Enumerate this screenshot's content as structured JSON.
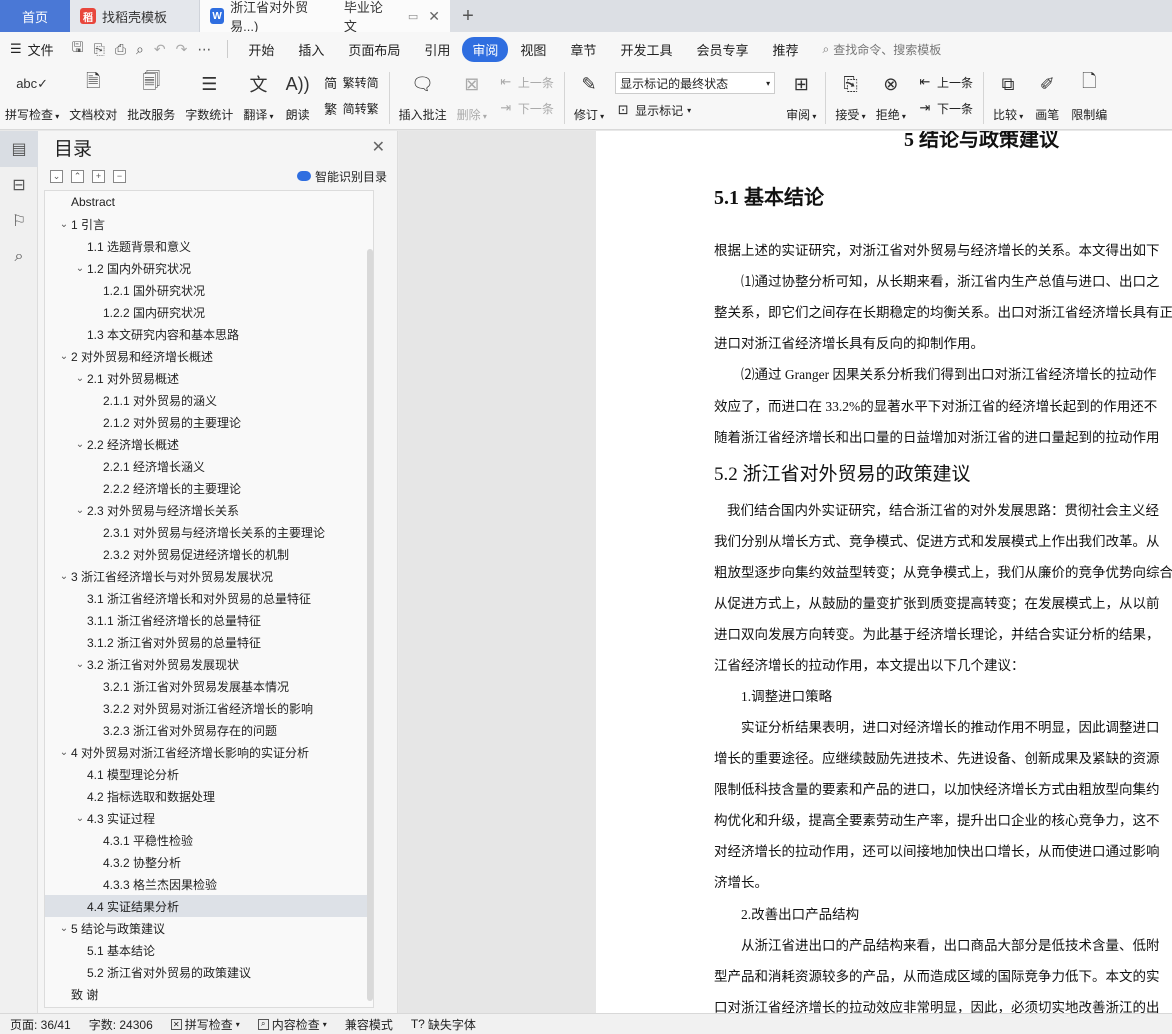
{
  "tabs": {
    "home": "首页",
    "t1": "找稻壳模板",
    "t2": "浙江省对外贸易...)",
    "t2_extra": "毕业论文",
    "add": "+"
  },
  "menu": {
    "file": "文件",
    "items": [
      "开始",
      "插入",
      "页面布局",
      "引用",
      "审阅",
      "视图",
      "章节",
      "开发工具",
      "会员专享",
      "推荐"
    ],
    "search": "查找命令、搜索模板"
  },
  "ribbon": {
    "spell": "拼写检查",
    "proof": "文档校对",
    "batch": "批改服务",
    "count": "字数统计",
    "translate": "翻译",
    "read": "朗读",
    "trad": "繁转简",
    "simp": "简转繁",
    "insert_comment": "插入批注",
    "delete": "删除",
    "prev": "上一条",
    "next": "下一条",
    "revise": "修订",
    "display_mode": "显示标记的最终状态",
    "show_marks": "显示标记",
    "review": "审阅",
    "accept": "接受",
    "reject": "拒绝",
    "prev2": "上一条",
    "next2": "下一条",
    "compare": "比较",
    "pen": "画笔",
    "restrict": "限制编"
  },
  "toc": {
    "title": "目录",
    "smart": "智能识别目录",
    "items": [
      {
        "text": "Abstract",
        "level": "lv1n",
        "arrow": ""
      },
      {
        "text": "1  引言",
        "level": "lv1",
        "arrow": "v"
      },
      {
        "text": "1.1  选题背景和意义",
        "level": "lv2n",
        "arrow": ""
      },
      {
        "text": "1.2  国内外研究状况",
        "level": "lv2",
        "arrow": "v"
      },
      {
        "text": "1.2.1    国外研究状况",
        "level": "lv3n",
        "arrow": ""
      },
      {
        "text": "1.2.2    国内研究状况",
        "level": "lv3n",
        "arrow": ""
      },
      {
        "text": "1.3  本文研究内容和基本思路",
        "level": "lv2n",
        "arrow": ""
      },
      {
        "text": "2  对外贸易和经济增长概述",
        "level": "lv1",
        "arrow": "v"
      },
      {
        "text": "2.1  对外贸易概述",
        "level": "lv2",
        "arrow": "v"
      },
      {
        "text": "2.1.1    对外贸易的涵义",
        "level": "lv3n",
        "arrow": ""
      },
      {
        "text": "2.1.2 对外贸易的主要理论",
        "level": "lv3n",
        "arrow": ""
      },
      {
        "text": "2.2 经济增长概述",
        "level": "lv2",
        "arrow": "v"
      },
      {
        "text": "2.2.1 经济增长涵义",
        "level": "lv3n",
        "arrow": ""
      },
      {
        "text": "2.2.2 经济增长的主要理论",
        "level": "lv3n",
        "arrow": ""
      },
      {
        "text": "2.3 对外贸易与经济增长关系",
        "level": "lv2",
        "arrow": "v"
      },
      {
        "text": "2.3.1 对外贸易与经济增长关系的主要理论",
        "level": "lv3n",
        "arrow": ""
      },
      {
        "text": "2.3.2 对外贸易促进经济增长的机制",
        "level": "lv3n",
        "arrow": ""
      },
      {
        "text": "3  浙江省经济增长与对外贸易发展状况",
        "level": "lv1",
        "arrow": "v"
      },
      {
        "text": "3.1  浙江省经济增长和对外贸易的总量特征",
        "level": "lv2n",
        "arrow": ""
      },
      {
        "text": "3.1.1 浙江省经济增长的总量特征",
        "level": "lv2n",
        "arrow": ""
      },
      {
        "text": "3.1.2 浙江省对外贸易的总量特征",
        "level": "lv2n",
        "arrow": ""
      },
      {
        "text": "3.2  浙江省对外贸易发展现状",
        "level": "lv2",
        "arrow": "v"
      },
      {
        "text": "3.2.1 浙江省对外贸易发展基本情况",
        "level": "lv3n",
        "arrow": ""
      },
      {
        "text": "3.2.2 对外贸易对浙江省经济增长的影响",
        "level": "lv3n",
        "arrow": ""
      },
      {
        "text": "3.2.3 浙江省对外贸易存在的问题",
        "level": "lv3n",
        "arrow": ""
      },
      {
        "text": "4  对外贸易对浙江省经济增长影响的实证分析",
        "level": "lv1",
        "arrow": "v"
      },
      {
        "text": "4.1  模型理论分析",
        "level": "lv2n",
        "arrow": ""
      },
      {
        "text": "4.2 指标选取和数据处理",
        "level": "lv2n",
        "arrow": ""
      },
      {
        "text": "4.3 实证过程",
        "level": "lv2",
        "arrow": "v"
      },
      {
        "text": "4.3.1 平稳性检验",
        "level": "lv3n",
        "arrow": ""
      },
      {
        "text": "4.3.2 协整分析",
        "level": "lv3n",
        "arrow": ""
      },
      {
        "text": "4.3.3 格兰杰因果检验",
        "level": "lv3n",
        "arrow": ""
      },
      {
        "text": "4.4 实证结果分析",
        "level": "lv2n",
        "arrow": "",
        "selected": true
      },
      {
        "text": "5  结论与政策建议",
        "level": "lv1",
        "arrow": "v"
      },
      {
        "text": "5.1 基本结论",
        "level": "lv2n",
        "arrow": ""
      },
      {
        "text": "5.2 浙江省对外贸易的政策建议",
        "level": "lv2n",
        "arrow": ""
      },
      {
        "text": "致  谢",
        "level": "lv1n",
        "arrow": ""
      }
    ]
  },
  "doc": {
    "chapter": "5  结论与政策建议",
    "h51": "5.1 基本结论",
    "p1": "根据上述的实证研究，对浙江省对外贸易与经济增长的关系。本文得出如下",
    "p2": "⑴通过协整分析可知，从长期来看，浙江省内生产总值与进口、出口之",
    "p3": "整关系，即它们之间存在长期稳定的均衡关系。出口对浙江省经济增长具有正",
    "p4": "进口对浙江省经济增长具有反向的抑制作用。",
    "p5": "⑵通过 Granger 因果关系分析我们得到出口对浙江省经济增长的拉动作",
    "p6": "效应了，而进口在 33.2%的显著水平下对浙江省的经济增长起到的作用还不",
    "p7": "随着浙江省经济增长和出口量的日益增加对浙江省的进口量起到的拉动作用",
    "h52": "5.2 浙江省对外贸易的政策建议",
    "p8": "我们结合国内外实证研究，结合浙江省的对外发展思路：贯彻社会主义经",
    "p9": "我们分别从增长方式、竞争模式、促进方式和发展模式上作出我们改革。从",
    "p10": "粗放型逐步向集约效益型转变；从竞争模式上，我们从廉价的竞争优势向综合",
    "p11": "从促进方式上，从鼓励的量变扩张到质变提高转变；在发展模式上，从以前",
    "p12": "进口双向发展方向转变。为此基于经济增长理论，并结合实证分析的结果，",
    "p13": "江省经济增长的拉动作用，本文提出以下几个建议：",
    "p14": "1.调整进口策略",
    "p15": "实证分析结果表明，进口对经济增长的推动作用不明显，因此调整进口",
    "p16": "增长的重要途径。应继续鼓励先进技术、先进设备、创新成果及紧缺的资源",
    "p17": "限制低科技含量的要素和产品的进口，以加快经济增长方式由粗放型向集约",
    "p18": "构优化和升级，提高全要素劳动生产率，提升出口企业的核心竞争力，这不",
    "p19": "对经济增长的拉动作用，还可以间接地加快出口增长，从而使进口通过影响",
    "p20": "济增长。",
    "p21": "2.改善出口产品结构",
    "p22": "从浙江省进出口的产品结构来看，出口商品大部分是低技术含量、低附",
    "p23": "型产品和消耗资源较多的产品，从而造成区域的国际竞争力低下。本文的实",
    "p24": "口对浙江省经济增长的拉动效应非常明显，因此，必须切实地改善浙江的出"
  },
  "status": {
    "page": "页面: 36/41",
    "words": "字数: 24306",
    "spell": "拼写检查",
    "content": "内容检查",
    "compat": "兼容模式",
    "font": "缺失字体"
  }
}
